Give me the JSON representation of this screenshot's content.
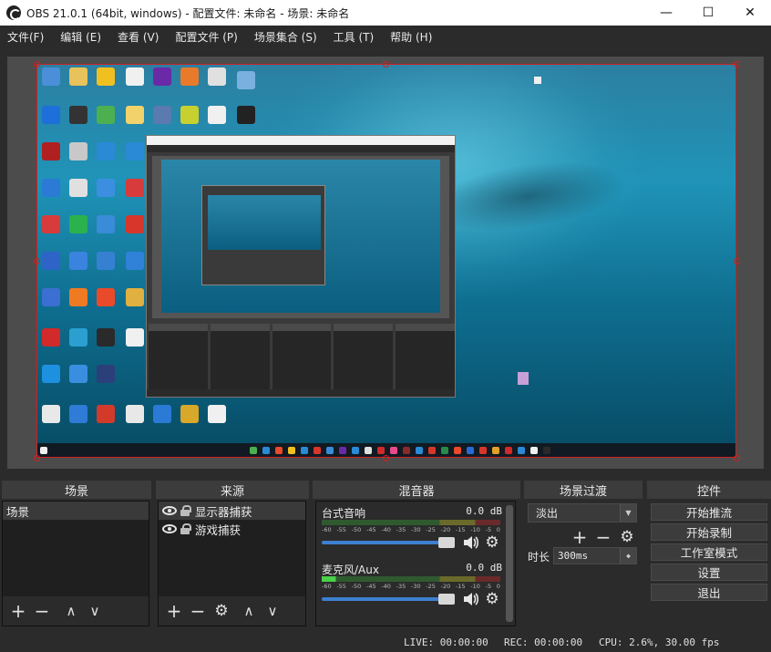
{
  "window": {
    "title": "OBS 21.0.1 (64bit, windows) - 配置文件: 未命名 - 场景: 未命名",
    "minimize_glyph": "—",
    "maximize_glyph": "☐",
    "close_glyph": "✕"
  },
  "menu": [
    {
      "label": "文件(F)"
    },
    {
      "label": "编辑 (E)"
    },
    {
      "label": "查看 (V)"
    },
    {
      "label": "配置文件 (P)"
    },
    {
      "label": "场景集合 (S)"
    },
    {
      "label": "工具 (T)"
    },
    {
      "label": "帮助 (H)"
    }
  ],
  "docks": {
    "scenes": {
      "header": "场景",
      "items": [
        {
          "label": "场景"
        }
      ]
    },
    "sources": {
      "header": "来源",
      "items": [
        {
          "label": "显示器捕获",
          "icons": [
            "eye-icon",
            "lock-icon"
          ]
        },
        {
          "label": "游戏捕获",
          "icons": [
            "eye-icon",
            "lock-icon"
          ]
        }
      ]
    },
    "mixer": {
      "header": "混音器",
      "channels": [
        {
          "name": "台式音响",
          "db": "0.0 dB",
          "level": 0.0,
          "volume": 1.0
        },
        {
          "name": "麦克风/Aux",
          "db": "0.0 dB",
          "level": 0.08,
          "volume": 1.0
        }
      ],
      "ticks": [
        "-60",
        "-55",
        "-50",
        "-45",
        "-40",
        "-35",
        "-30",
        "-25",
        "-20",
        "-15",
        "-10",
        "-5",
        "0"
      ]
    },
    "transitions": {
      "header": "场景过渡",
      "selected": "淡出",
      "duration_label": "时长",
      "duration_value": "300ms"
    },
    "controls": {
      "header": "控件",
      "buttons": [
        {
          "label": "开始推流"
        },
        {
          "label": "开始录制"
        },
        {
          "label": "工作室模式"
        },
        {
          "label": "设置"
        },
        {
          "label": "退出"
        }
      ]
    }
  },
  "toolbar_glyphs": {
    "add": "+",
    "remove": "−",
    "up": "∧",
    "down": "∨",
    "settings": "⚙"
  },
  "status": {
    "live": "LIVE: 00:00:00",
    "rec": "REC: 00:00:00",
    "cpu": "CPU: 2.6%, 30.00 fps"
  },
  "colors": {
    "background": "#2b2b2b",
    "selection_border": "#d02020",
    "volume_slider": "#3d7fd0"
  }
}
